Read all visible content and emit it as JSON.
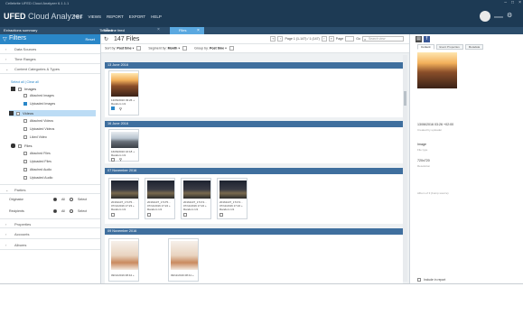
{
  "window": {
    "title": "Cellebrite UFED Cloud Analyzer 6.1.1.1"
  },
  "app": {
    "logo_brand": "UFED",
    "logo_rest": "Cloud Analyzer",
    "menu": [
      "FILE",
      "VIEWS",
      "REPORT",
      "EXPORT",
      "HELP"
    ],
    "user": "xxxxx"
  },
  "tabs": [
    {
      "label": "Extractions summary"
    },
    {
      "label": "Timeline table"
    },
    {
      "label": "Timeline feed"
    },
    {
      "label": "Files"
    }
  ],
  "filters": {
    "title": "Filters",
    "reset": "Reset",
    "sections": [
      "Data Sources",
      "Time Ranges",
      "Content Categories & Types"
    ],
    "select_all": "Select all",
    "clear_all": "Clear all",
    "images": {
      "label": "Images",
      "items": [
        "Attached Images",
        "Uploaded Images"
      ]
    },
    "videos": {
      "label": "Videos",
      "items": [
        "Attached Videos",
        "Uploaded Videos",
        "Liked Video"
      ]
    },
    "files": {
      "label": "Files",
      "items": [
        "Attached Files",
        "Uploaded Files",
        "Attached Audio",
        "Uploaded Audio"
      ]
    },
    "parties_section": "Parties",
    "parties": [
      {
        "label": "Originator",
        "all": "All",
        "select": "Select"
      },
      {
        "label": "Recipients",
        "all": "All",
        "select": "Select"
      }
    ],
    "more_sections": [
      "Properties",
      "Accounts",
      "Albums"
    ]
  },
  "center": {
    "count": "147 Files",
    "sort_by_label": "Sort by:",
    "sort_by_value": "Post time",
    "segment_by_label": "Segment by:",
    "segment_by_value": "Month",
    "group_by_label": "Group by:",
    "group_by_value": "Post time",
    "page_info": "Page 1 (1-147) / 1 (147)",
    "page_label": "Page",
    "go": "Go",
    "search_placeholder": "Search view",
    "groups": [
      {
        "date": "13 June 2016",
        "cards": [
          {
            "line1": "13/06/2016 03:26 +",
            "line2": "Random 1/1",
            "photo": "bus"
          }
        ]
      },
      {
        "date": "16 June 2016",
        "cards": [
          {
            "line1": "16/06/2016 16:18 +",
            "line2": "Random 1/1",
            "photo": "city"
          }
        ]
      },
      {
        "date": "07 November 2016",
        "cards": [
          {
            "line1": "20161107_17175...",
            "line2": "07/11/2016 17:23 +",
            "line3": "Random 1/1",
            "photo": "night"
          },
          {
            "line1": "20161107_17175...",
            "line2": "07/11/2016 17:22 +",
            "line3": "Random 1/1",
            "photo": "night"
          },
          {
            "line1": "20161107_17174...",
            "line2": "07/11/2016 17:22 +",
            "line3": "Random 1/1",
            "photo": "night"
          },
          {
            "line1": "20161107_17174...",
            "line2": "07/11/2016 17:22 +",
            "line3": "Random 1/1",
            "photo": "night"
          }
        ]
      },
      {
        "date": "09 November 2016",
        "cards": [
          {
            "line1": "09/11/2016 08:42 +",
            "photo": "pills"
          },
          {
            "line1": "09/11/2016 08:41 +",
            "photo": "pills"
          }
        ]
      }
    ]
  },
  "details": {
    "tabs": [
      "Content",
      "Event Properties",
      "Metadata"
    ],
    "timestamp": "13/06/2016 03:26 +02:00",
    "timestamp_label": "Created by uploader",
    "type": "Image",
    "type_label": "File type",
    "resolution": "720x720",
    "resolution_label": "Resolution",
    "note": "Album of 3 (bump source)",
    "include_label": "Include in report"
  }
}
